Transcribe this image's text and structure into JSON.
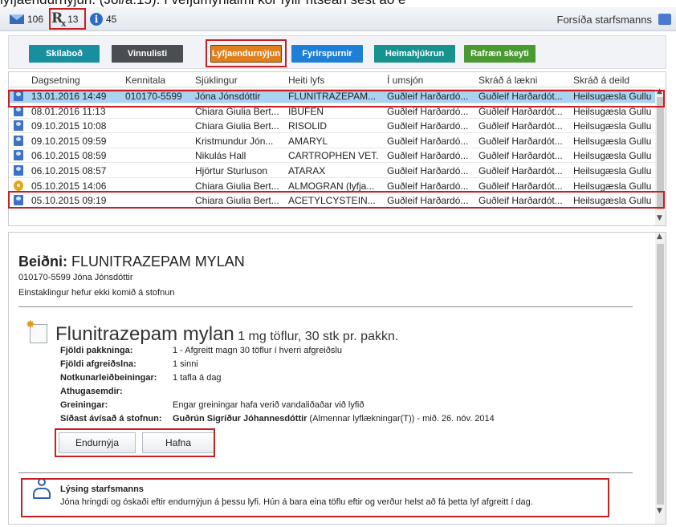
{
  "caption": "lyfjaendurnýjun. (Jól/a.15). Í vefjumynlaimi kor fylir ritsean sést ao e",
  "topbar": {
    "messages_count": "106",
    "rx_count": "13",
    "info_count": "45",
    "right_label": "Forsíða starfsmanns"
  },
  "buttons": {
    "skilabod": "Skilaboð",
    "vinnulisti": "Vinnulisti",
    "lyfjaendurnyjun": "Lyfjaendurnýjun",
    "fyrirspurnir": "Fyrirspurnir",
    "heimahjukrun": "Heimahjúkrun",
    "rafraen_skeyti": "Rafræn skeyti"
  },
  "table": {
    "columns": [
      "Dagsetning",
      "Kennitala",
      "Sjúklingur",
      "Heiti lyfs",
      "Í umsjón",
      "Skráð á lækni",
      "Skráð á deild"
    ],
    "rows": [
      {
        "date": "13.01.2016 14:49",
        "kt": "010170-5599",
        "patient": "Jóna Jónsdóttir",
        "drug": "FLUNITRAZEPAM...",
        "owner": "Guðleif Harðardó...",
        "doctor": "Guðleif Harðardót...",
        "dept": "Heilsugæsla Gullu"
      },
      {
        "date": "08.01.2016 11:13",
        "kt": "",
        "patient": "Chiara Giulia Bert...",
        "drug": "IBUFEN",
        "owner": "Guðleif Harðardó...",
        "doctor": "Guðleif Harðardót...",
        "dept": "Heilsugæsla Gullu"
      },
      {
        "date": "09.10.2015 10:08",
        "kt": "",
        "patient": "Chiara Giulia Bert...",
        "drug": "RISOLID",
        "owner": "Guðleif Harðardó...",
        "doctor": "Guðleif Harðardót...",
        "dept": "Heilsugæsla Gullu"
      },
      {
        "date": "09.10.2015 09:59",
        "kt": "",
        "patient": "Kristmundur Jón...",
        "drug": "AMARYL",
        "owner": "Guðleif Harðardó...",
        "doctor": "Guðleif Harðardót...",
        "dept": "Heilsugæsla Gullu"
      },
      {
        "date": "06.10.2015 08:59",
        "kt": "",
        "patient": "Nikulás Hall",
        "drug": "CARTROPHEN VET.",
        "owner": "Guðleif Harðardó...",
        "doctor": "Guðleif Harðardót...",
        "dept": "Heilsugæsla Gullu"
      },
      {
        "date": "06.10.2015 08:57",
        "kt": "",
        "patient": "Hjörtur Sturluson",
        "drug": "ATARAX",
        "owner": "Guðleif Harðardó...",
        "doctor": "Guðleif Harðardót...",
        "dept": "Heilsugæsla Gullu"
      },
      {
        "date": "05.10.2015 14:06",
        "kt": "",
        "patient": "Chiara Giulia Bert...",
        "drug": "ALMOGRAN (lyfja...",
        "owner": "Guðleif Harðardó...",
        "doctor": "Guðleif Harðardót...",
        "dept": "Heilsugæsla Gullu"
      },
      {
        "date": "05.10.2015 09:19",
        "kt": "",
        "patient": "Chiara Giulia Bert...",
        "drug": "ACETYLCYSTEIN...",
        "owner": "Guðleif Harðardó...",
        "doctor": "Guðleif Harðardót...",
        "dept": "Heilsugæsla Gullu"
      }
    ]
  },
  "detail": {
    "request_label": "Beiðni:",
    "request_drug": "FLUNITRAZEPAM MYLAN",
    "patient_line": "010170-5599 Jóna Jónsdóttir",
    "notice": "Einstaklingur hefur ekki komið á stofnun",
    "drug_name": "Flunitrazepam mylan",
    "drug_desc": "1 mg töflur, 30 stk pr. pakkn.",
    "fields": [
      {
        "label": "Fjöldi pakkninga:",
        "value": "1 - Afgreitt magn 30 töflur í hverri afgreiðslu"
      },
      {
        "label": "Fjöldi afgreiðslna:",
        "value": "1 sinni"
      },
      {
        "label": "Notkunarleiðbeiningar:",
        "value": "1 tafla á dag"
      },
      {
        "label": "Athugasemdir:",
        "value": ""
      },
      {
        "label": "Greiningar:",
        "value": "Engar greiningar hafa verið vandaliðaðar við lyfið"
      }
    ],
    "last_prescribed_label": "Síðast ávísað á stofnun:",
    "last_prescribed_name": "Guðrún Sigríður Jóhannesdóttir",
    "last_prescribed_rest": "(Almennar lyflækningar(T)) - mið. 26. nóv. 2014",
    "renew_button": "Endurnýja",
    "reject_button": "Hafna",
    "staff_title": "Lýsing starfsmanns",
    "staff_text": "Jóna hringdi og óskaði eftir endurnýjun á þessu lyfi.  Hún á bara eina töflu eftir og verður helst að fá þetta lyf afgreitt í dag."
  },
  "colors": {
    "highlight": "#c81e24",
    "selected_row": "#aad3f2",
    "btn_skilabod": "#178f9f",
    "btn_vinnulisti": "#4a4d52",
    "btn_lyfja": "#e07f1c",
    "btn_fyrirspurnir": "#1d7fd6",
    "btn_heima": "#16928f",
    "btn_rafraen": "#4a9a32"
  }
}
